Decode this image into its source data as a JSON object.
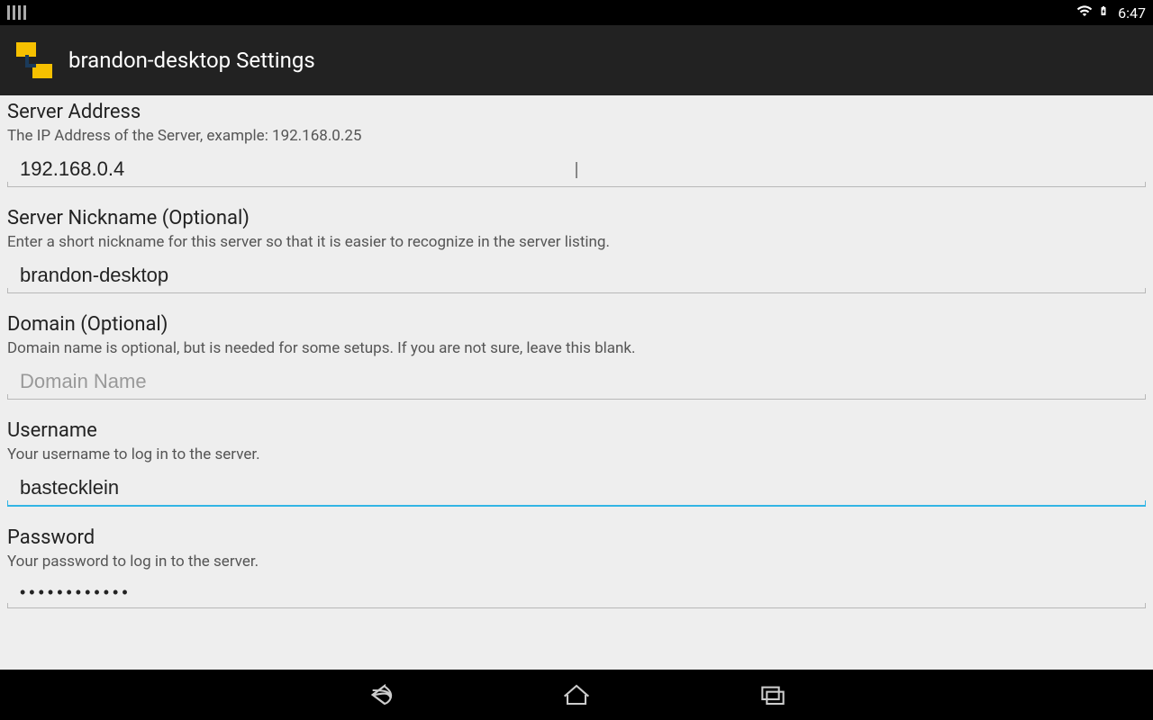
{
  "status": {
    "time": "6:47"
  },
  "header": {
    "title": "brandon-desktop Settings"
  },
  "fields": {
    "server_address": {
      "title": "Server Address",
      "desc": "The IP Address of the Server, example: 192.168.0.25",
      "value": "192.168.0.4",
      "placeholder": ""
    },
    "server_nickname": {
      "title": "Server Nickname (Optional)",
      "desc": "Enter a short nickname for this server so that it is easier to recognize in the server listing.",
      "value": "brandon-desktop",
      "placeholder": ""
    },
    "domain": {
      "title": "Domain (Optional)",
      "desc": "Domain name is optional, but is needed for some setups. If you are not sure, leave this blank.",
      "value": "",
      "placeholder": "Domain Name"
    },
    "username": {
      "title": "Username",
      "desc": "Your username to log in to the server.",
      "value": "bastecklein",
      "placeholder": ""
    },
    "password": {
      "title": "Password",
      "desc": "Your password to log in to the server.",
      "value": "••••••••••••",
      "placeholder": ""
    }
  }
}
